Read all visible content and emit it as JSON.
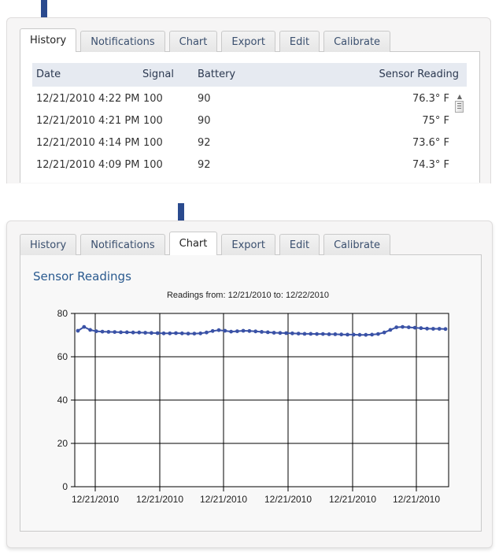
{
  "tabs": [
    "History",
    "Notifications",
    "Chart",
    "Export",
    "Edit",
    "Calibrate"
  ],
  "history_panel": {
    "active_tab": "History",
    "columns": [
      "Date",
      "Signal",
      "Battery",
      "Sensor Reading"
    ],
    "rows": [
      {
        "date": "12/21/2010 4:22 PM",
        "signal": "100",
        "battery": "90",
        "reading": "76.3° F"
      },
      {
        "date": "12/21/2010 4:21 PM",
        "signal": "100",
        "battery": "90",
        "reading": "75° F"
      },
      {
        "date": "12/21/2010 4:14 PM",
        "signal": "100",
        "battery": "92",
        "reading": "73.6° F"
      },
      {
        "date": "12/21/2010 4:09 PM",
        "signal": "100",
        "battery": "92",
        "reading": "74.3° F"
      }
    ]
  },
  "chart_panel": {
    "active_tab": "Chart",
    "section_title": "Sensor Readings"
  },
  "colors": {
    "accent": "#2a5a8f",
    "series": "#3a52a6",
    "arrow": "#2a4a8e"
  },
  "chart_data": {
    "type": "line",
    "title": "Readings from: 12/21/2010 to: 12/22/2010",
    "xlabel": "",
    "ylabel": "",
    "ylim": [
      0,
      80
    ],
    "yticks": [
      0,
      20,
      40,
      60,
      80
    ],
    "xtick_labels": [
      "12/21/2010",
      "12/21/2010",
      "12/21/2010",
      "12/21/2010",
      "12/21/2010",
      "12/21/2010"
    ],
    "grid": true,
    "series": [
      {
        "values": [
          72.0,
          73.8,
          72.4,
          71.8,
          71.6,
          71.5,
          71.4,
          71.3,
          71.3,
          71.2,
          71.2,
          71.1,
          71.0,
          70.9,
          70.8,
          70.8,
          70.9,
          70.8,
          70.7,
          70.7,
          70.8,
          71.2,
          71.9,
          72.3,
          72.0,
          71.6,
          71.8,
          72.0,
          71.9,
          71.7,
          71.5,
          71.3,
          71.1,
          71.0,
          70.9,
          70.8,
          70.7,
          70.6,
          70.6,
          70.5,
          70.5,
          70.4,
          70.4,
          70.3,
          70.2,
          70.2,
          70.1,
          70.1,
          70.2,
          70.5,
          71.2,
          72.4,
          73.6,
          73.8,
          73.6,
          73.4,
          73.2,
          73.0,
          72.9,
          72.9,
          72.8
        ]
      }
    ]
  }
}
